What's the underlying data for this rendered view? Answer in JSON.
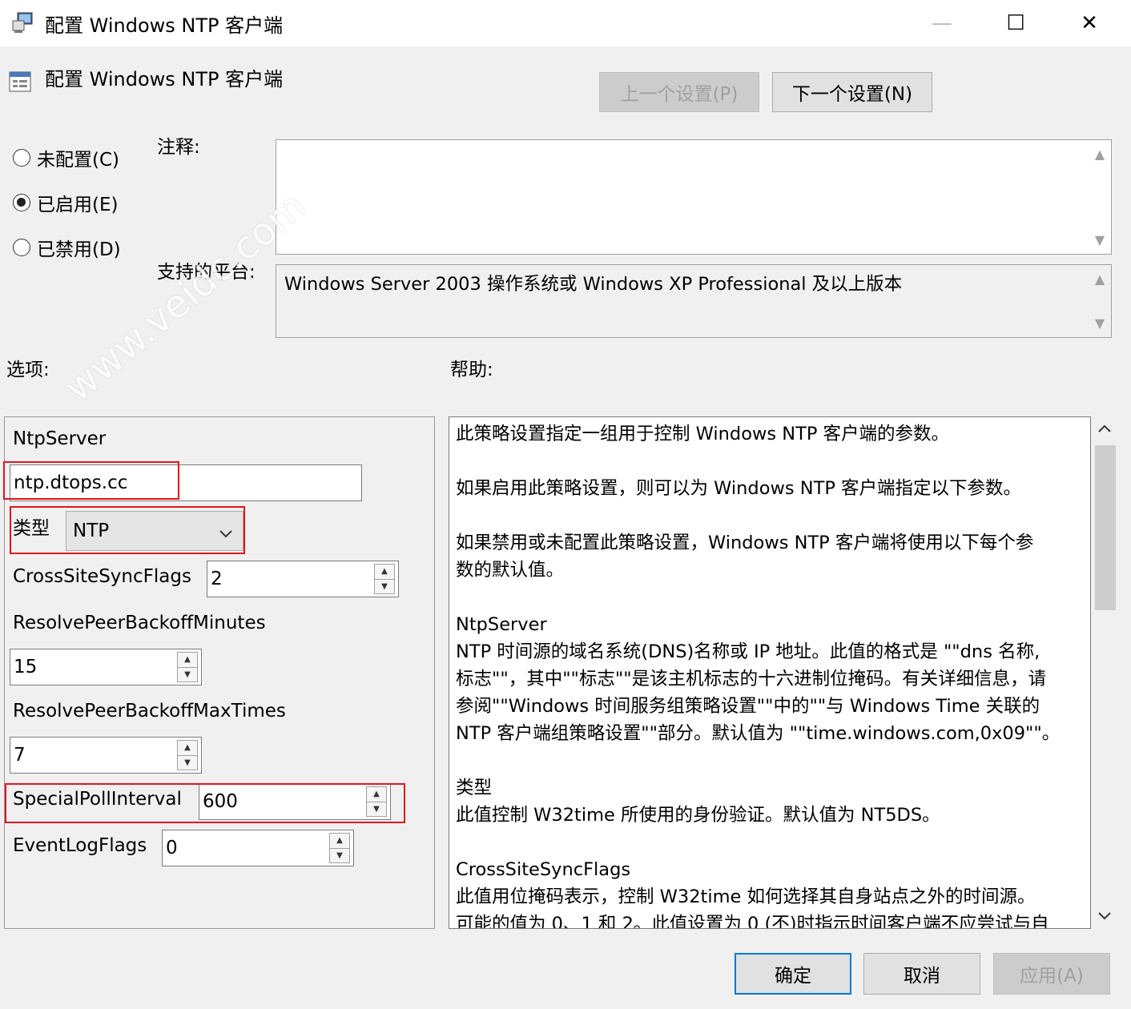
{
  "window": {
    "title": "配置 Windows NTP 客户端",
    "controls": {
      "minimize": "—",
      "maximize": "☐",
      "close": "✕"
    }
  },
  "header": {
    "title": "配置 Windows NTP 客户端",
    "prev_label": "上一个设置(P)",
    "next_label": "下一个设置(N)"
  },
  "state": {
    "not_configured": "未配置(C)",
    "enabled": "已启用(E)",
    "disabled": "已禁用(D)",
    "selected": "enabled"
  },
  "comment": {
    "label": "注释:",
    "value": ""
  },
  "platform": {
    "label": "支持的平台:",
    "value": "Windows Server 2003 操作系统或 Windows XP Professional 及以上版本"
  },
  "options": {
    "label": "选项:",
    "ntp_server_label": "NtpServer",
    "ntp_server_value": "ntp.dtops.cc",
    "type_label": "类型",
    "type_value": "NTP",
    "cross_site_label": "CrossSiteSyncFlags",
    "cross_site_value": "2",
    "resolve_minutes_label": "ResolvePeerBackoffMinutes",
    "resolve_minutes_value": "15",
    "resolve_times_label": "ResolvePeerBackoffMaxTimes",
    "resolve_times_value": "7",
    "special_poll_label": "SpecialPollInterval",
    "special_poll_value": "600",
    "event_log_label": "EventLogFlags",
    "event_log_value": "0"
  },
  "help": {
    "label": "帮助:",
    "text": "此策略设置指定一组用于控制 Windows NTP 客户端的参数。\n\n如果启用此策略设置，则可以为 Windows NTP 客户端指定以下参数。\n\n如果禁用或未配置此策略设置，Windows NTP 客户端将使用以下每个参\n数的默认值。\n\nNtpServer\nNTP 时间源的域名系统(DNS)名称或 IP 地址。此值的格式是 \"\"dns 名称,\n标志\"\"，其中\"\"标志\"\"是该主机标志的十六进制位掩码。有关详细信息，请\n参阅\"\"Windows 时间服务组策略设置\"\"中的\"\"与 Windows Time 关联的\nNTP 客户端组策略设置\"\"部分。默认值为 \"\"time.windows.com,0x09\"\"。\n\n类型\n此值控制 W32time 所使用的身份验证。默认值为 NT5DS。\n\nCrossSiteSyncFlags\n此值用位掩码表示，控制 W32time 如何选择其自身站点之外的时间源。\n可能的值为 0、1 和 2。此值设置为 0 (不)时指示时间客户端不应尝试与自"
  },
  "footer": {
    "ok": "确定",
    "cancel": "取消",
    "apply": "应用(A)"
  },
  "watermark": "www.veidc.com",
  "colors": {
    "highlight": "#e0151f",
    "focus": "#0078d7"
  }
}
